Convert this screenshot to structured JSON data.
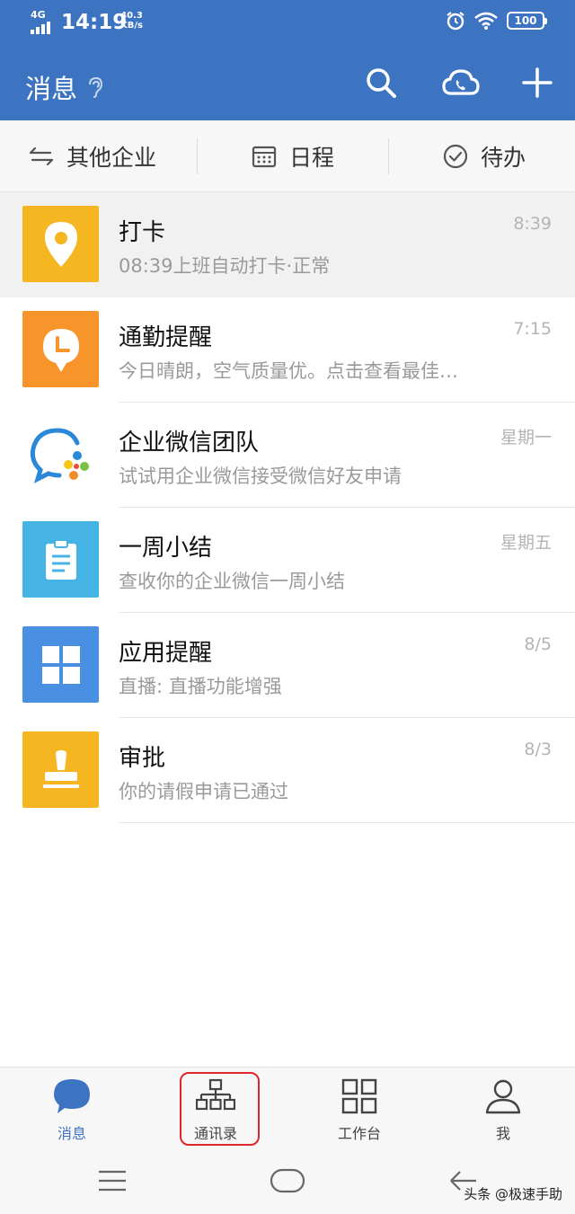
{
  "status_bar": {
    "network": "4G",
    "time": "14:19",
    "speed_value": "40.3",
    "speed_unit": "KB/s",
    "battery": "100"
  },
  "header": {
    "title": "消息",
    "icons": [
      "ear-icon",
      "search-icon",
      "cloud-phone-icon",
      "plus-icon"
    ]
  },
  "quickbar": {
    "other_company": "其他企业",
    "schedule": "日程",
    "todo": "待办"
  },
  "messages": [
    {
      "name": "打卡",
      "preview": "08:39上班自动打卡·正常",
      "time": "8:39",
      "icon": "location-icon",
      "color": "#f5b622"
    },
    {
      "name": "通勤提醒",
      "preview": "今日晴朗，空气质量优。点击查看最佳…",
      "time": "7:15",
      "icon": "clock-pin-icon",
      "color": "#f7942a"
    },
    {
      "name": "企业微信团队",
      "preview": "试试用企业微信接受微信好友申请",
      "time": "星期一",
      "icon": "wecom-logo-icon",
      "color": "#ffffff"
    },
    {
      "name": "一周小结",
      "preview": "查收你的企业微信一周小结",
      "time": "星期五",
      "icon": "clipboard-icon",
      "color": "#45b4e4"
    },
    {
      "name": "应用提醒",
      "preview": "直播: 直播功能增强",
      "time": "8/5",
      "icon": "grid-icon",
      "color": "#4a90e2"
    },
    {
      "name": "审批",
      "preview": "你的请假申请已通过",
      "time": "8/3",
      "icon": "stamp-icon",
      "color": "#f5b622"
    }
  ],
  "bottom_nav": {
    "messages": "消息",
    "contacts": "通讯录",
    "workbench": "工作台",
    "me": "我",
    "accent": "#3d74c2",
    "highlight_color": "#e0262a"
  },
  "watermark": "头条 @极速手助"
}
